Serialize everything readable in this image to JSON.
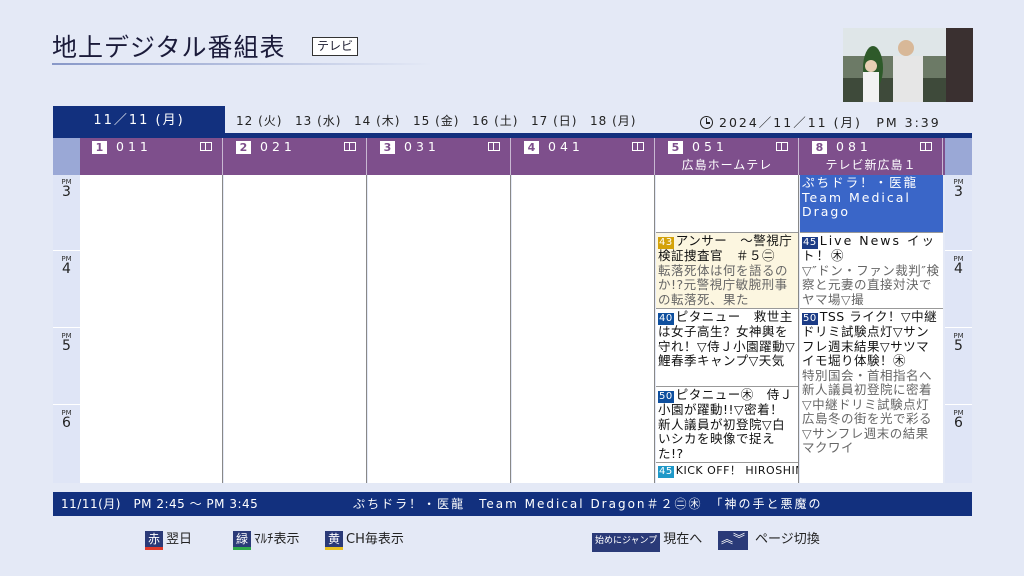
{
  "header": {
    "title": "地上デジタル番組表",
    "badge": "テレビ"
  },
  "tabs": {
    "current": "11／11 (月)",
    "days": [
      "12 (火)",
      "13 (水)",
      "14 (木)",
      "15 (金)",
      "16 (土)",
      "17 (日)",
      "18 (月)"
    ],
    "clock": "2024／11／11 (月)　PM 3:39"
  },
  "channels": [
    {
      "num": "1",
      "code": "011",
      "name": ""
    },
    {
      "num": "2",
      "code": "021",
      "name": ""
    },
    {
      "num": "3",
      "code": "031",
      "name": ""
    },
    {
      "num": "4",
      "code": "041",
      "name": ""
    },
    {
      "num": "5",
      "code": "051",
      "name": "広島ホームテレ"
    },
    {
      "num": "8",
      "code": "081",
      "name": "テレビ新広島１"
    }
  ],
  "hours": [
    {
      "pm": "PM",
      "h": "3"
    },
    {
      "pm": "PM",
      "h": "4"
    },
    {
      "pm": "PM",
      "h": "5"
    },
    {
      "pm": "PM",
      "h": "6"
    }
  ],
  "programs": {
    "ch5": [
      {
        "min": "43",
        "title": "アンサー　～警視庁検証捜査官　＃５㊁",
        "desc": "転落死体は何を語るのか!?元警視庁敏腕刑事の転落死、果た"
      },
      {
        "min": "40",
        "title": "ピタニュー　救世主は女子高生？女神輿を守れ！▽侍Ｊ小園躍動▽鯉春季キャンプ▽天気",
        "desc": ""
      },
      {
        "min": "50",
        "title": "ピタニュー㊍　侍Ｊ小園が躍動!!▽密着！新人議員が初登院▽白いシカを映像で捉えた!?",
        "desc": ""
      },
      {
        "min": "45",
        "title": "KICK OFF！ HIROSHIM",
        "desc": ""
      }
    ],
    "ch8": [
      {
        "min": "",
        "title": "ぷちドラ！・医龍　Team Medical Drago",
        "desc": ""
      },
      {
        "min": "45",
        "title": "Live News イット！㊍",
        "desc": "▽″ドン・ファン裁判″検察と元妻の直接対決でヤマ場▽撮"
      },
      {
        "min": "50",
        "title": "TSS ライク！▽中継ドリミ試験点灯▽サンフレ週末結果▽サツマイモ堀り体験！㊍",
        "desc": "特別国会・首相指名へ新人議員初登院に密着▽中継ドリミ試験点灯広島冬の街を光で彩る▽サンフレ週末の結果マクワイ"
      }
    ]
  },
  "infobar": {
    "time": "11/11(月)　PM 2:45 ～ PM 3:45",
    "title": "ぷちドラ！・医龍　Team Medical Dragon＃２㊁㊍　「神の手と悪魔の"
  },
  "legend": {
    "red_key": "赤",
    "red_label": "翌日",
    "green_key": "緑",
    "green_label": "ﾏﾙﾁ表示",
    "yellow_key": "黄",
    "yellow_label": "CH毎表示",
    "jump_key": "始めにジャンプ",
    "jump_label": "現在へ",
    "page_key": "︽︾",
    "page_label": "ページ切換"
  }
}
